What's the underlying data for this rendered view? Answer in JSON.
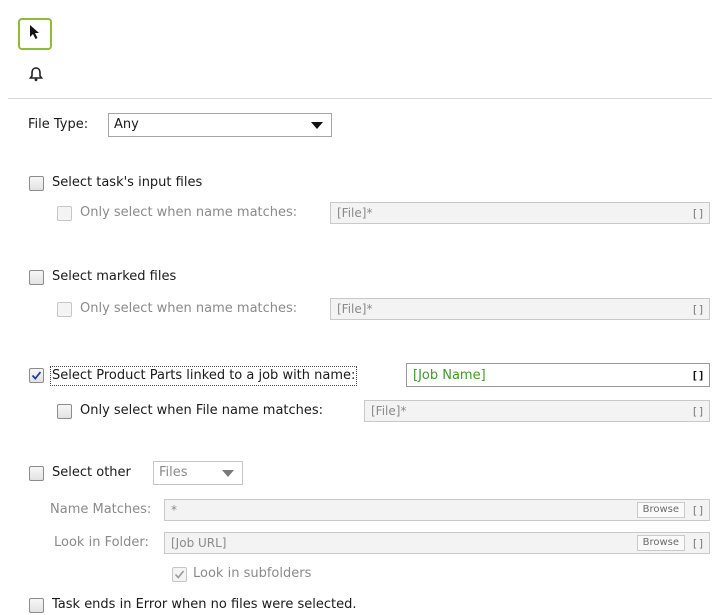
{
  "toolbar": {
    "pointer_icon": "arrow-pointer-icon",
    "bell_icon": "bell-icon"
  },
  "file_type": {
    "label": "File Type:",
    "value": "Any"
  },
  "input_files": {
    "label": "Select task's input files",
    "checked": false,
    "sub_label": "Only select when name matches:",
    "sub_value": "[File]*",
    "brackets": "[]"
  },
  "marked_files": {
    "label": "Select marked files",
    "checked": false,
    "sub_label": "Only select when name matches:",
    "sub_value": "[File]*",
    "brackets": "[]"
  },
  "product_parts": {
    "label": "Select Product Parts linked to a job with name:",
    "checked": true,
    "value": "[Job Name]",
    "brackets": "[]",
    "sub_label": "Only select when File name matches:",
    "sub_value": "[File]*",
    "sub_brackets": "[]"
  },
  "other": {
    "label": "Select other",
    "type_value": "Files",
    "name_matches_label": "Name Matches:",
    "name_matches_value": "*",
    "look_in_label": "Look in Folder:",
    "look_in_value": "[Job URL]",
    "browse_label": "Browse",
    "brackets": "[]",
    "subfolders_label": "Look in subfolders",
    "subfolders_checked": true
  },
  "error_option": {
    "label": "Task ends in Error when no files were selected.",
    "checked": false
  }
}
